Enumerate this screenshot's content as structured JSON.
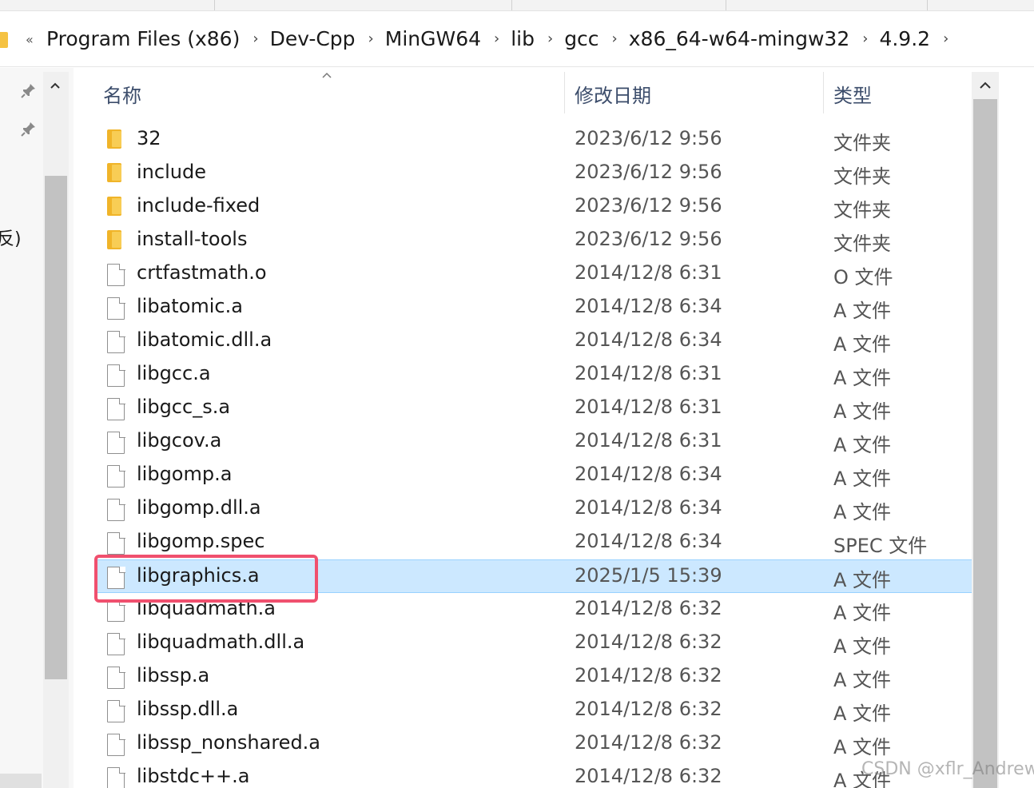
{
  "address": {
    "overflow_icon": "«",
    "breadcrumbs": [
      "Program Files (x86)",
      "Dev-Cpp",
      "MinGW64",
      "lib",
      "gcc",
      "x86_64-w64-mingw32",
      "4.9.2"
    ]
  },
  "nav": {
    "partial_label": "反)"
  },
  "columns": {
    "name": "名称",
    "date": "修改日期",
    "type": "类型"
  },
  "files": [
    {
      "name": "32",
      "date": "2023/6/12 9:56",
      "type": "文件夹",
      "icon": "folder-icon"
    },
    {
      "name": "include",
      "date": "2023/6/12 9:56",
      "type": "文件夹",
      "icon": "folder-icon"
    },
    {
      "name": "include-fixed",
      "date": "2023/6/12 9:56",
      "type": "文件夹",
      "icon": "folder-icon"
    },
    {
      "name": "install-tools",
      "date": "2023/6/12 9:56",
      "type": "文件夹",
      "icon": "folder-icon"
    },
    {
      "name": "crtfastmath.o",
      "date": "2014/12/8 6:31",
      "type": "O 文件",
      "icon": "file-icon"
    },
    {
      "name": "libatomic.a",
      "date": "2014/12/8 6:34",
      "type": "A 文件",
      "icon": "file-icon"
    },
    {
      "name": "libatomic.dll.a",
      "date": "2014/12/8 6:34",
      "type": "A 文件",
      "icon": "file-icon"
    },
    {
      "name": "libgcc.a",
      "date": "2014/12/8 6:31",
      "type": "A 文件",
      "icon": "file-icon"
    },
    {
      "name": "libgcc_s.a",
      "date": "2014/12/8 6:31",
      "type": "A 文件",
      "icon": "file-icon"
    },
    {
      "name": "libgcov.a",
      "date": "2014/12/8 6:31",
      "type": "A 文件",
      "icon": "file-icon"
    },
    {
      "name": "libgomp.a",
      "date": "2014/12/8 6:34",
      "type": "A 文件",
      "icon": "file-icon"
    },
    {
      "name": "libgomp.dll.a",
      "date": "2014/12/8 6:34",
      "type": "A 文件",
      "icon": "file-icon"
    },
    {
      "name": "libgomp.spec",
      "date": "2014/12/8 6:34",
      "type": "SPEC 文件",
      "icon": "file-icon"
    },
    {
      "name": "libgraphics.a",
      "date": "2025/1/5 15:39",
      "type": "A 文件",
      "icon": "file-icon",
      "selected": true
    },
    {
      "name": "libquadmath.a",
      "date": "2014/12/8 6:32",
      "type": "A 文件",
      "icon": "file-icon"
    },
    {
      "name": "libquadmath.dll.a",
      "date": "2014/12/8 6:32",
      "type": "A 文件",
      "icon": "file-icon"
    },
    {
      "name": "libssp.a",
      "date": "2014/12/8 6:32",
      "type": "A 文件",
      "icon": "file-icon"
    },
    {
      "name": "libssp.dll.a",
      "date": "2014/12/8 6:32",
      "type": "A 文件",
      "icon": "file-icon"
    },
    {
      "name": "libssp_nonshared.a",
      "date": "2014/12/8 6:32",
      "type": "A 文件",
      "icon": "file-icon"
    },
    {
      "name": "libstdc++.a",
      "date": "2014/12/8 6:32",
      "type": "A 文件",
      "icon": "file-icon"
    }
  ],
  "watermark": "CSDN @xflr_Andrew",
  "colors": {
    "selection": "#cce8ff",
    "highlight_box": "#f0506e",
    "folder": "#f0b429"
  }
}
